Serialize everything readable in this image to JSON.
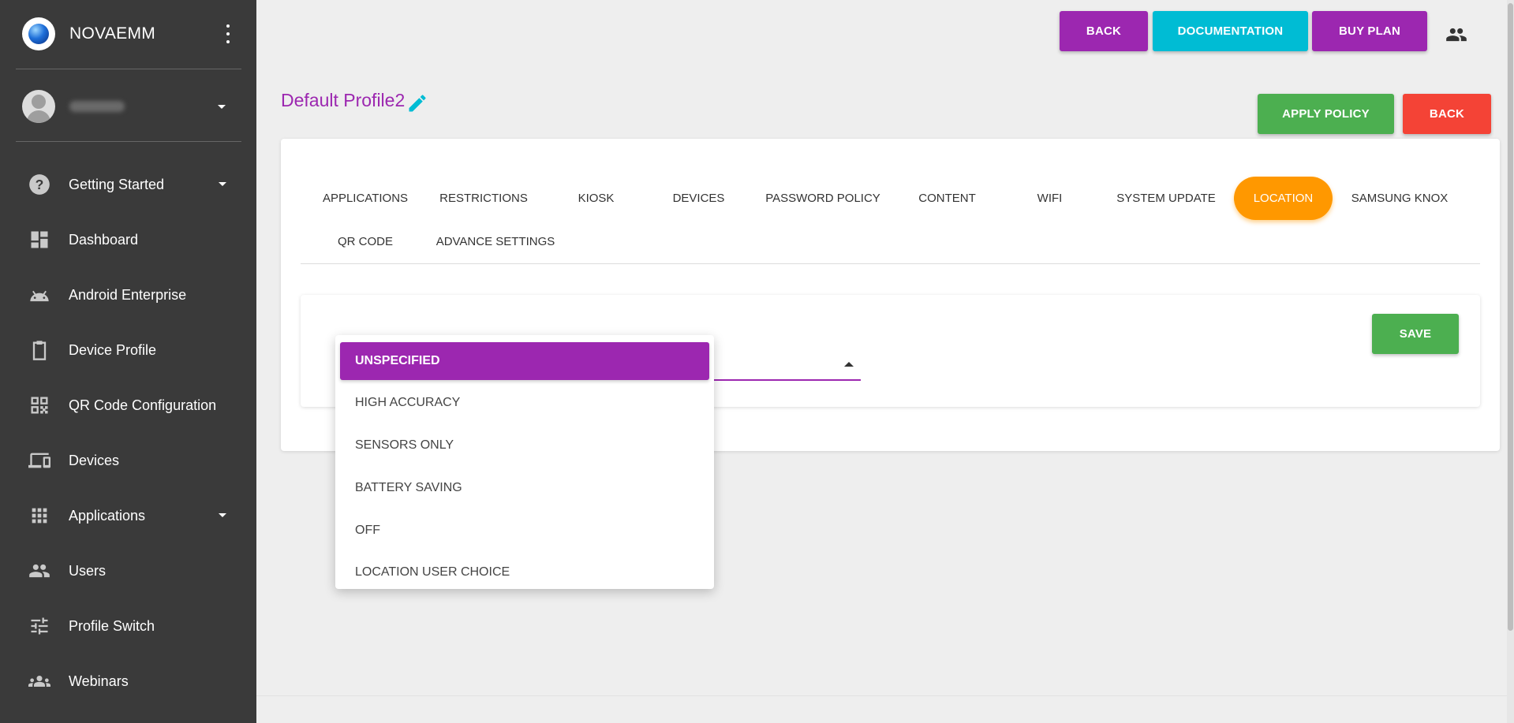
{
  "sidebar": {
    "brand": "NOVAEMM",
    "items": [
      {
        "label": "Getting Started",
        "icon": "help-circle-icon",
        "expandable": true
      },
      {
        "label": "Dashboard",
        "icon": "dashboard-icon",
        "expandable": false
      },
      {
        "label": "Android Enterprise",
        "icon": "android-icon",
        "expandable": false
      },
      {
        "label": "Device Profile",
        "icon": "clipboard-icon",
        "expandable": false
      },
      {
        "label": "QR Code Configuration",
        "icon": "qr-code-icon",
        "expandable": false
      },
      {
        "label": "Devices",
        "icon": "devices-icon",
        "expandable": false
      },
      {
        "label": "Applications",
        "icon": "apps-grid-icon",
        "expandable": true
      },
      {
        "label": "Users",
        "icon": "people-icon",
        "expandable": false
      },
      {
        "label": "Profile Switch",
        "icon": "tune-icon",
        "expandable": false
      },
      {
        "label": "Webinars",
        "icon": "groups-icon",
        "expandable": false
      }
    ]
  },
  "topbar": {
    "back_label": "BACK",
    "documentation_label": "DOCUMENTATION",
    "buy_plan_label": "BUY PLAN"
  },
  "profile": {
    "title": "Default Profile2",
    "apply_policy_label": "APPLY POLICY",
    "back_label": "BACK"
  },
  "tabs": [
    {
      "label": "APPLICATIONS"
    },
    {
      "label": "RESTRICTIONS"
    },
    {
      "label": "KIOSK"
    },
    {
      "label": "DEVICES"
    },
    {
      "label": "PASSWORD POLICY"
    },
    {
      "label": "CONTENT"
    },
    {
      "label": "WIFI"
    },
    {
      "label": "SYSTEM UPDATE"
    },
    {
      "label": "LOCATION",
      "active": true
    },
    {
      "label": "SAMSUNG KNOX"
    },
    {
      "label": "QR CODE"
    },
    {
      "label": "ADVANCE SETTINGS"
    }
  ],
  "location": {
    "save_label": "SAVE",
    "selected": "UNSPECIFIED",
    "options": [
      "UNSPECIFIED",
      "HIGH ACCURACY",
      "SENSORS ONLY",
      "BATTERY SAVING",
      "OFF",
      "LOCATION USER CHOICE"
    ]
  },
  "colors": {
    "sidebar": "#3a3a3a",
    "purple": "#9c27b0",
    "cyan": "#00bcd4",
    "green": "#4caf50",
    "red": "#f44336",
    "orange": "#ff9800"
  }
}
